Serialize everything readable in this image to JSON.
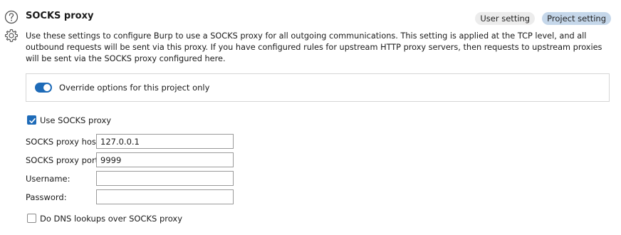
{
  "header": {
    "title": "SOCKS proxy",
    "scope_buttons": [
      "User setting",
      "Project setting"
    ],
    "active_scope": "Project setting"
  },
  "description": "Use these settings to configure Burp to use a SOCKS proxy for all outgoing communications. This setting is applied at the TCP level, and all outbound requests will be sent via this proxy. If you have configured rules for upstream HTTP proxy servers, then requests to upstream proxies will be sent via the SOCKS proxy configured here.",
  "override": {
    "label": "Override options for this project only",
    "enabled": true
  },
  "use_socks": {
    "label": "Use SOCKS proxy",
    "checked": true
  },
  "fields": {
    "host": {
      "label": "SOCKS proxy host:",
      "value": "127.0.0.1"
    },
    "port": {
      "label": "SOCKS proxy port:",
      "value": "9999"
    },
    "username": {
      "label": "Username:",
      "value": ""
    },
    "password": {
      "label": "Password:",
      "value": ""
    }
  },
  "dns": {
    "label": "Do DNS lookups over SOCKS proxy",
    "checked": false
  },
  "colors": {
    "accent": "#1e6bb8",
    "active_pill": "#c5d7ea",
    "pill": "#ececec"
  },
  "icons": {
    "help": "help-icon",
    "settings": "gear-icon"
  }
}
